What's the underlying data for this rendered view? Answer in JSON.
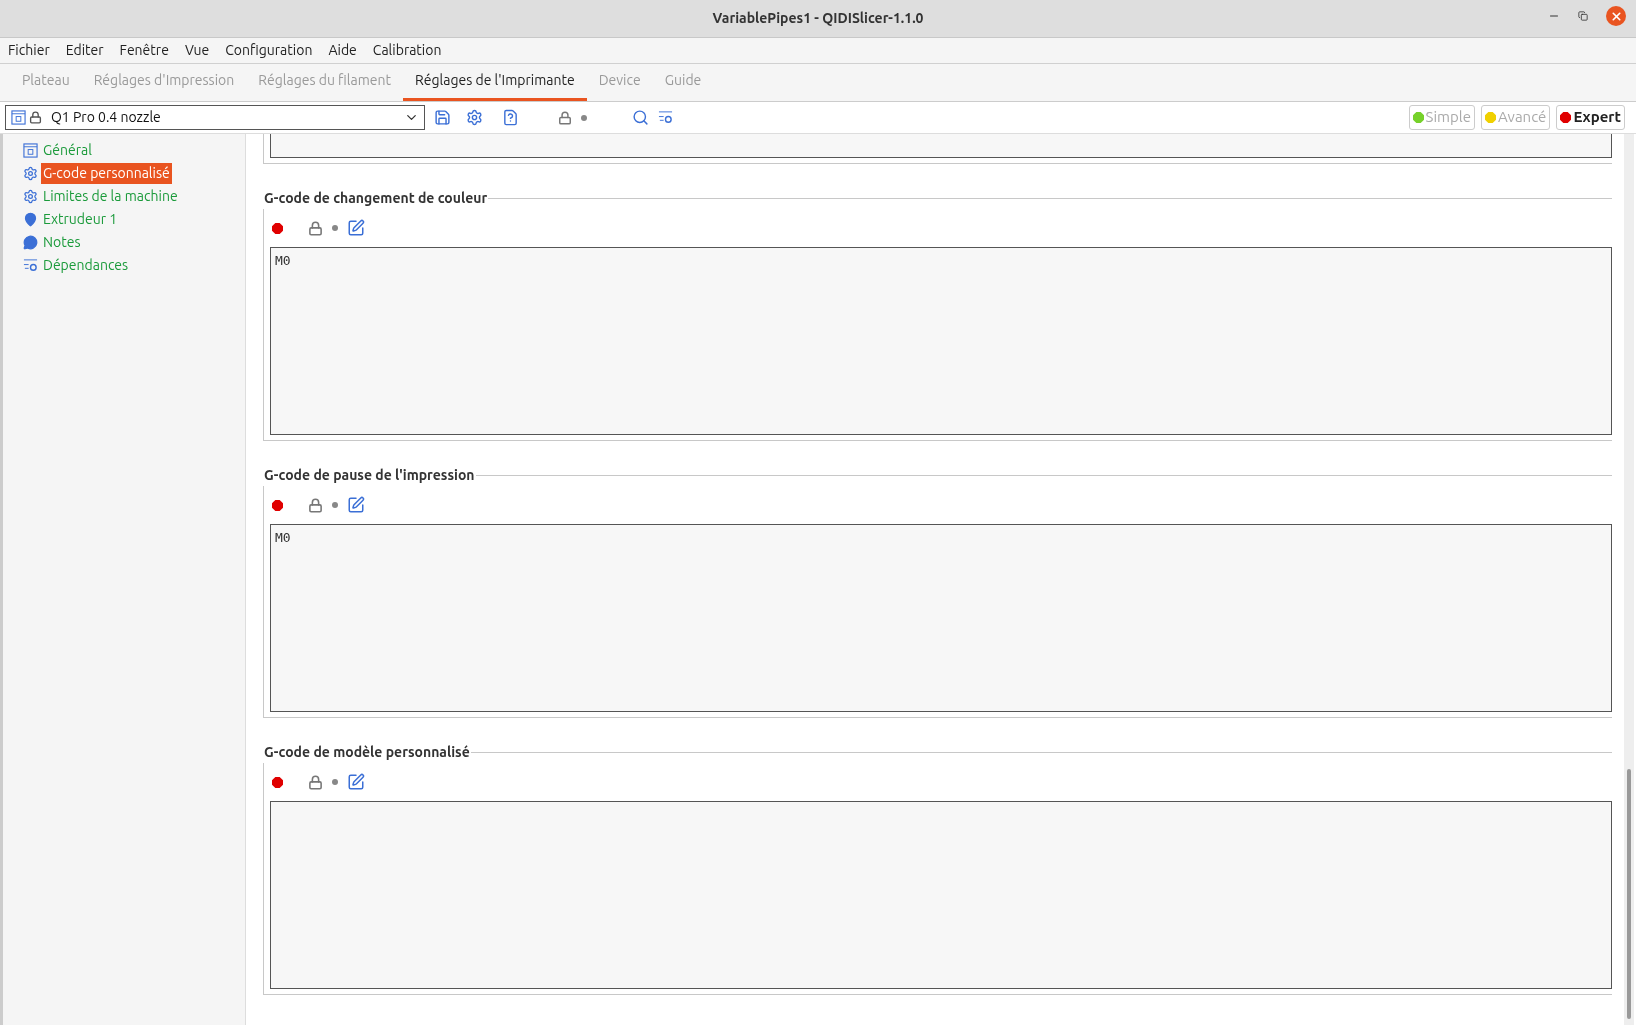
{
  "window": {
    "title": "VariablePipes1 - QIDISlicer-1.1.0"
  },
  "menu": [
    {
      "label": "Fichier"
    },
    {
      "label": "Editer"
    },
    {
      "label": "Fenêtre"
    },
    {
      "label": "Vue"
    },
    {
      "label": "Configuration"
    },
    {
      "label": "Aide"
    },
    {
      "label": "Calibration"
    }
  ],
  "tabs": [
    {
      "label": "Plateau",
      "selected": false
    },
    {
      "label": "Réglages d'Impression",
      "selected": false
    },
    {
      "label": "Réglages du filament",
      "selected": false
    },
    {
      "label": "Réglages de l'Imprimante",
      "selected": true
    },
    {
      "label": "Device",
      "selected": false
    },
    {
      "label": "Guide",
      "selected": false
    }
  ],
  "preset": {
    "value": "Q1 Pro 0.4 nozzle"
  },
  "modes": [
    {
      "label": "Simple",
      "color": "#76d12a",
      "selected": false
    },
    {
      "label": "Avancé",
      "color": "#f0d000",
      "selected": false
    },
    {
      "label": "Expert",
      "color": "#e00000",
      "selected": true
    }
  ],
  "sidebar": {
    "items": [
      {
        "label": "Général",
        "kind": "printer",
        "selected": false
      },
      {
        "label": "G-code personnalisé",
        "kind": "gear",
        "selected": true
      },
      {
        "label": "Limites de la machine",
        "kind": "gear",
        "selected": false
      },
      {
        "label": "Extrudeur 1",
        "kind": "extruder",
        "selected": false
      },
      {
        "label": "Notes",
        "kind": "notes",
        "selected": false
      },
      {
        "label": "Dépendances",
        "kind": "deps",
        "selected": false
      }
    ]
  },
  "sections": [
    {
      "title": "G-code de changement de couleur",
      "value": "M0"
    },
    {
      "title": "G-code de pause de l'impression",
      "value": "M0"
    },
    {
      "title": "G-code de modèle personnalisé"
    }
  ]
}
